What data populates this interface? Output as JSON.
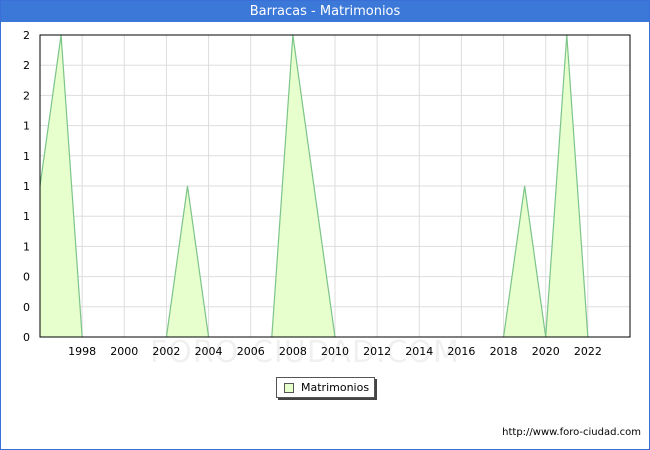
{
  "header": {
    "title": "Barracas - Matrimonios"
  },
  "footer": {
    "source": "http://www.foro-ciudad.com"
  },
  "watermark": "FORO-CIUDAD.COM",
  "colors": {
    "title_bg": "#3b78d8",
    "fill": "#e6ffcc",
    "line": "#7cc48a",
    "grid": "#dddddd"
  },
  "chart_data": {
    "type": "area",
    "title": "Barracas - Matrimonios",
    "xlabel": "",
    "ylabel": "",
    "xlim": [
      1996,
      2024
    ],
    "ylim": [
      0,
      2
    ],
    "x": [
      1996,
      1997,
      1998,
      1999,
      2000,
      2001,
      2002,
      2003,
      2004,
      2005,
      2006,
      2007,
      2008,
      2009,
      2010,
      2011,
      2012,
      2013,
      2014,
      2015,
      2016,
      2017,
      2018,
      2019,
      2020,
      2021,
      2022
    ],
    "x_ticks": [
      "1998",
      "2000",
      "2002",
      "2004",
      "2006",
      "2008",
      "2010",
      "2012",
      "2014",
      "2016",
      "2018",
      "2020",
      "2022"
    ],
    "y_ticks": [
      "0",
      "0",
      "0",
      "1",
      "1",
      "1",
      "1",
      "1",
      "2",
      "2",
      "2"
    ],
    "grid": true,
    "legend": "bottom-center",
    "series": [
      {
        "name": "Matrimonios",
        "values": [
          1,
          2,
          0,
          0,
          0,
          0,
          0,
          1,
          0,
          0,
          0,
          0,
          2,
          1,
          0,
          0,
          0,
          0,
          0,
          0,
          0,
          0,
          0,
          1,
          0,
          2,
          0
        ]
      }
    ]
  }
}
